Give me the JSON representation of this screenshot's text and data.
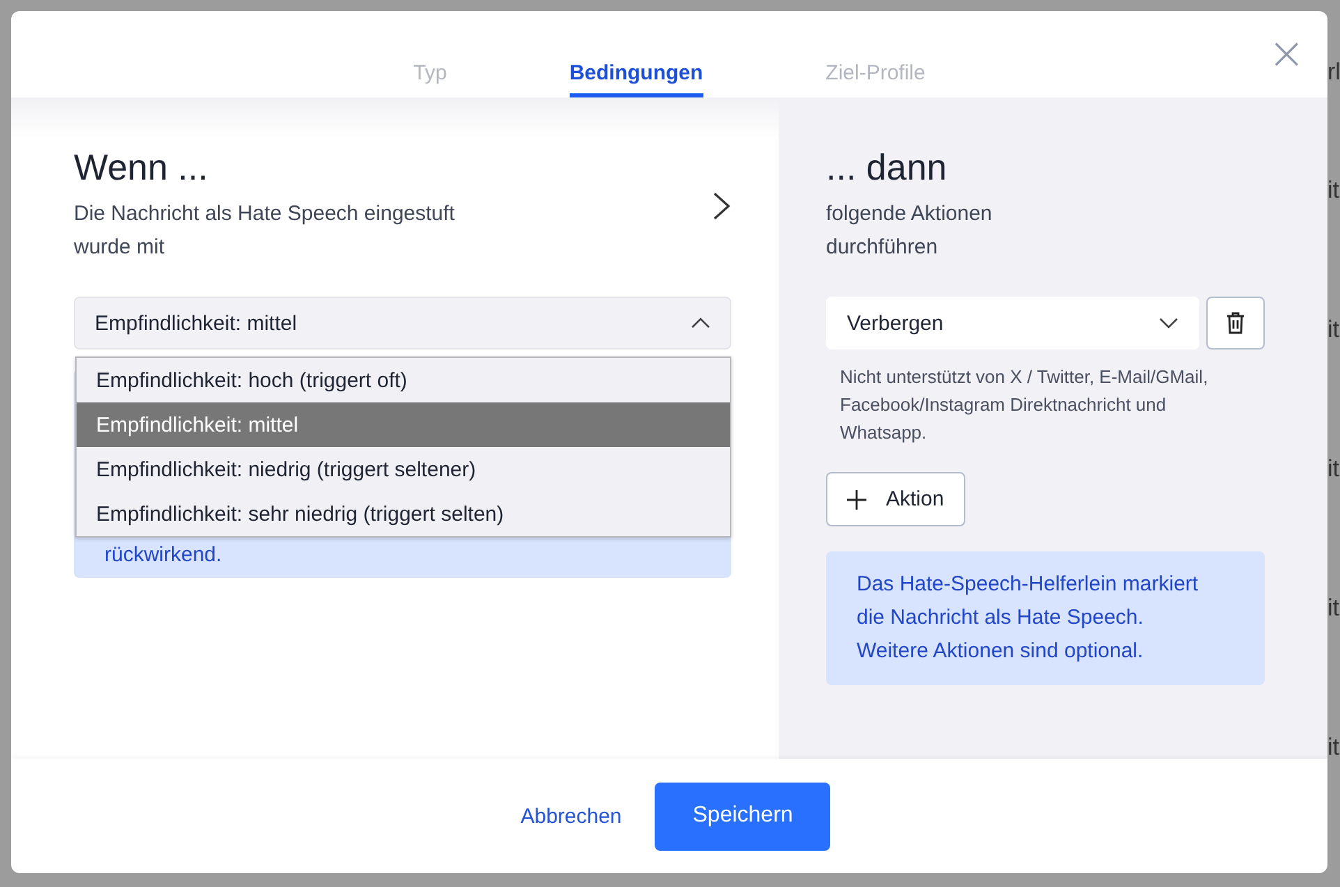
{
  "background_page": {
    "fragments": [
      "rl",
      "it",
      "it",
      "it",
      "it",
      "it"
    ]
  },
  "dialog": {
    "tabs": [
      {
        "label": "Typ",
        "selected": false
      },
      {
        "label": "Bedingungen",
        "selected": true
      },
      {
        "label": "Ziel-Profile",
        "selected": false
      }
    ],
    "close": "×",
    "conditions": {
      "title": "Wenn ...",
      "subtitle": "Die Nachricht als Hate Speech eingestuft wurde mit",
      "select": {
        "value": "Empfindlichkeit: mittel",
        "expanded": true,
        "options": [
          {
            "label": "Empfindlichkeit: hoch (triggert oft)",
            "selected": false
          },
          {
            "label": "Empfindlichkeit: mittel",
            "selected": true
          },
          {
            "label": "Empfindlichkeit: niedrig (triggert seltener)",
            "selected": false
          },
          {
            "label": "Empfindlichkeit: sehr niedrig (triggert selten)",
            "selected": false
          }
        ]
      },
      "info": "rückwirkend."
    },
    "actions": {
      "title": "... dann",
      "subtitle": "folgende Aktionen durchführen",
      "select": {
        "value": "Verbergen",
        "expanded": false
      },
      "note": "Nicht unterstützt von X / Twitter, E-Mail/GMail, Facebook/Instagram Direktnachricht und Whatsapp.",
      "add_button": "Aktion",
      "info": "Das Hate-Speech-Helferlein markiert die Nachricht als Hate Speech. Weitere Aktionen sind optional."
    },
    "buttons": {
      "cancel": "Abbrechen",
      "save": "Speichern"
    }
  }
}
